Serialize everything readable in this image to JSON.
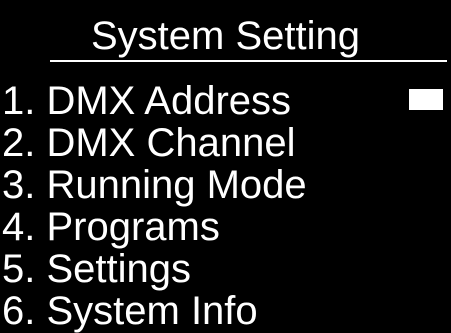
{
  "screen": {
    "title": "System Setting",
    "selected_item": 1
  },
  "menu": {
    "items": [
      {
        "label": "1. DMX Address"
      },
      {
        "label": "2. DMX Channel"
      },
      {
        "label": "3. Running Mode"
      },
      {
        "label": "4. Programs"
      },
      {
        "label": "5. Settings"
      },
      {
        "label": "6. System Info"
      }
    ]
  },
  "colors": {
    "background": "#000000",
    "foreground": "#ffffff"
  }
}
